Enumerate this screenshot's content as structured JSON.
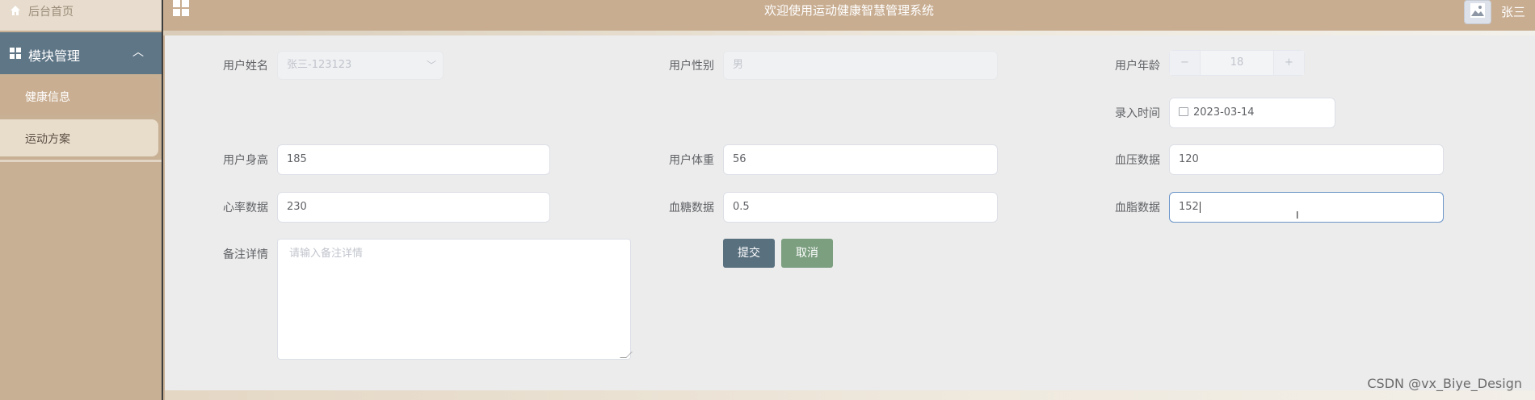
{
  "header": {
    "title": "欢迎使用运动健康智慧管理系统",
    "username": "张三"
  },
  "sidebar": {
    "home_label": "后台首页",
    "module_label": "模块管理",
    "items": [
      {
        "label": "健康信息"
      },
      {
        "label": "运动方案"
      }
    ]
  },
  "form": {
    "user_name": {
      "label": "用户姓名",
      "value": "张三-123123"
    },
    "user_gender": {
      "label": "用户性别",
      "value": "男"
    },
    "user_age": {
      "label": "用户年龄",
      "value": "18",
      "minus": "−",
      "plus": "+"
    },
    "entry_time": {
      "label": "录入时间",
      "value": "2023-03-14"
    },
    "height": {
      "label": "用户身高",
      "value": "185"
    },
    "weight": {
      "label": "用户体重",
      "value": "56"
    },
    "blood_pressure": {
      "label": "血压数据",
      "value": "120"
    },
    "heart_rate": {
      "label": "心率数据",
      "value": "230"
    },
    "blood_sugar": {
      "label": "血糖数据",
      "value": "0.5"
    },
    "blood_lipid": {
      "label": "血脂数据",
      "value": "152"
    },
    "remarks": {
      "label": "备注详情",
      "placeholder": "请输入备注详情"
    },
    "submit_label": "提交",
    "cancel_label": "取消"
  },
  "watermark": "CSDN @vx_Biye_Design",
  "colors": {
    "sidebar_bg": "#c8b094",
    "header_bg": "#c8ad91",
    "module_bg": "#5f7687",
    "submit_bg": "#59707f",
    "cancel_bg": "#7c9f80",
    "main_bg": "#ececec"
  }
}
